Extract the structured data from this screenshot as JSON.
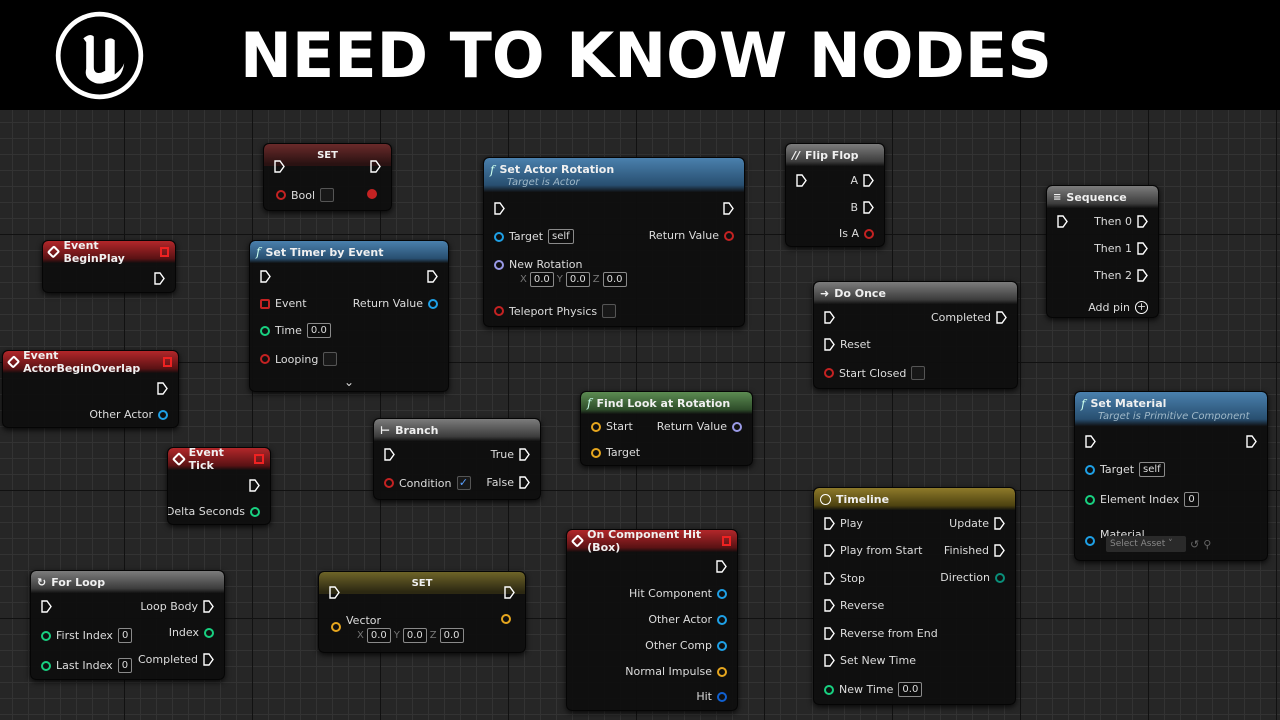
{
  "banner": {
    "title": "NEED TO KNOW NODES",
    "logo_letter": "u"
  },
  "colors": {
    "exec": "#ffffff",
    "bool": "#c42222",
    "object": "#1ea0e6",
    "int": "#18d080",
    "vector": "#e6a61e"
  },
  "nodes": {
    "set_bool": {
      "title": "SET",
      "pin": "Bool"
    },
    "set_actor_rotation": {
      "title": "Set Actor Rotation",
      "subtitle": "Target is Actor",
      "target": "Target",
      "target_val": "self",
      "return": "Return Value",
      "new_rot": "New Rotation",
      "x": "X",
      "y": "Y",
      "z": "Z",
      "xv": "0.0",
      "yv": "0.0",
      "zv": "0.0",
      "teleport": "Teleport Physics"
    },
    "flip_flop": {
      "title": "Flip Flop",
      "a": "A",
      "b": "B",
      "is_a": "Is A"
    },
    "sequence": {
      "title": "Sequence",
      "then0": "Then 0",
      "then1": "Then 1",
      "then2": "Then 2",
      "add_pin": "Add pin"
    },
    "begin_play": {
      "title": "Event BeginPlay"
    },
    "set_timer": {
      "title": "Set Timer by Event",
      "event": "Event",
      "return": "Return Value",
      "time": "Time",
      "time_val": "0.0",
      "looping": "Looping"
    },
    "do_once": {
      "title": "Do Once",
      "completed": "Completed",
      "reset": "Reset",
      "start_closed": "Start Closed"
    },
    "begin_overlap": {
      "title": "Event ActorBeginOverlap",
      "other_actor": "Other Actor"
    },
    "find_look": {
      "title": "Find Look at Rotation",
      "start": "Start",
      "return": "Return Value",
      "target": "Target"
    },
    "branch": {
      "title": "Branch",
      "true_lbl": "True",
      "condition": "Condition",
      "false_lbl": "False"
    },
    "event_tick": {
      "title": "Event Tick",
      "delta": "Delta Seconds"
    },
    "set_material": {
      "title": "Set Material",
      "subtitle": "Target is Primitive Component",
      "target": "Target",
      "target_val": "self",
      "element_index": "Element Index",
      "element_val": "0",
      "material": "Material",
      "select_asset": "Select Asset"
    },
    "timeline": {
      "title": "Timeline",
      "play": "Play",
      "update": "Update",
      "play_from_start": "Play from Start",
      "finished": "Finished",
      "stop": "Stop",
      "direction": "Direction",
      "reverse": "Reverse",
      "reverse_from_end": "Reverse from End",
      "set_new_time": "Set New Time",
      "new_time": "New Time",
      "new_time_val": "0.0"
    },
    "on_hit": {
      "title": "On Component Hit (Box)",
      "hit_component": "Hit Component",
      "other_actor": "Other Actor",
      "other_comp": "Other Comp",
      "normal_impulse": "Normal Impulse",
      "hit": "Hit"
    },
    "for_loop": {
      "title": "For Loop",
      "loop_body": "Loop Body",
      "first_index": "First Index",
      "first_val": "0",
      "index": "Index",
      "last_index": "Last Index",
      "last_val": "0",
      "completed": "Completed"
    },
    "set_vector": {
      "title": "SET",
      "vector": "Vector",
      "x": "X",
      "y": "Y",
      "z": "Z",
      "xv": "0.0",
      "yv": "0.0",
      "zv": "0.0"
    }
  }
}
